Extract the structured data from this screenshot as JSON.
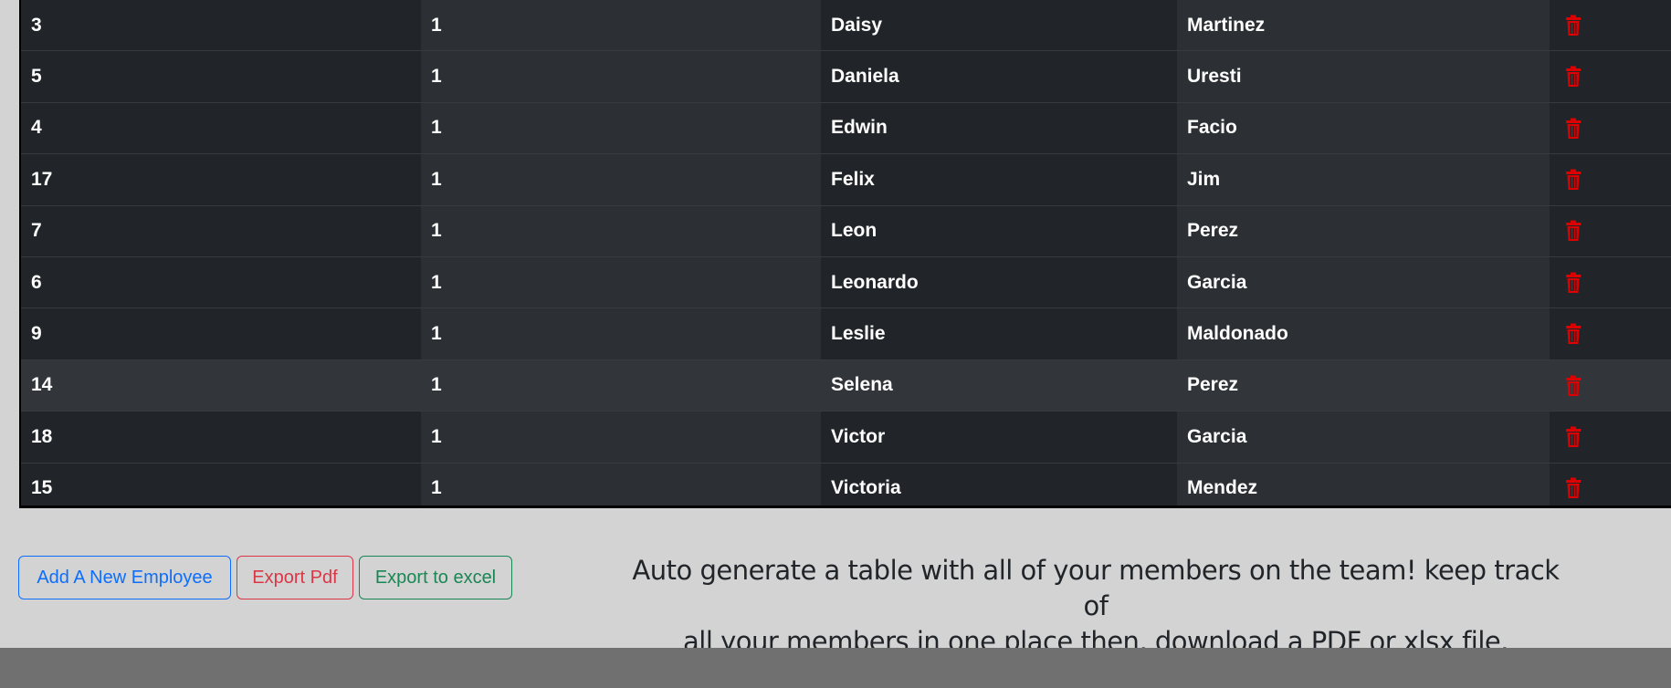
{
  "table": {
    "rows": [
      {
        "id": "3",
        "team": "1",
        "first": "Daisy",
        "last": "Martinez"
      },
      {
        "id": "5",
        "team": "1",
        "first": "Daniela",
        "last": "Uresti"
      },
      {
        "id": "4",
        "team": "1",
        "first": "Edwin",
        "last": "Facio"
      },
      {
        "id": "17",
        "team": "1",
        "first": "Felix",
        "last": "Jim"
      },
      {
        "id": "7",
        "team": "1",
        "first": "Leon",
        "last": "Perez"
      },
      {
        "id": "6",
        "team": "1",
        "first": "Leonardo",
        "last": "Garcia"
      },
      {
        "id": "9",
        "team": "1",
        "first": "Leslie",
        "last": "Maldonado"
      },
      {
        "id": "14",
        "team": "1",
        "first": "Selena",
        "last": "Perez"
      },
      {
        "id": "18",
        "team": "1",
        "first": "Victor",
        "last": "Garcia"
      },
      {
        "id": "15",
        "team": "1",
        "first": "Victoria",
        "last": "Mendez"
      }
    ],
    "delete_icon": "trash-icon",
    "delete_color": "#dc0000"
  },
  "actions": {
    "add_label": "Add A New Employee",
    "pdf_label": "Export Pdf",
    "excel_label": "Export to excel"
  },
  "description": {
    "line1": "Auto generate a table with all of your members on the team! keep track of",
    "line2": "all your members in one place then, download a PDF or xlsx file."
  }
}
